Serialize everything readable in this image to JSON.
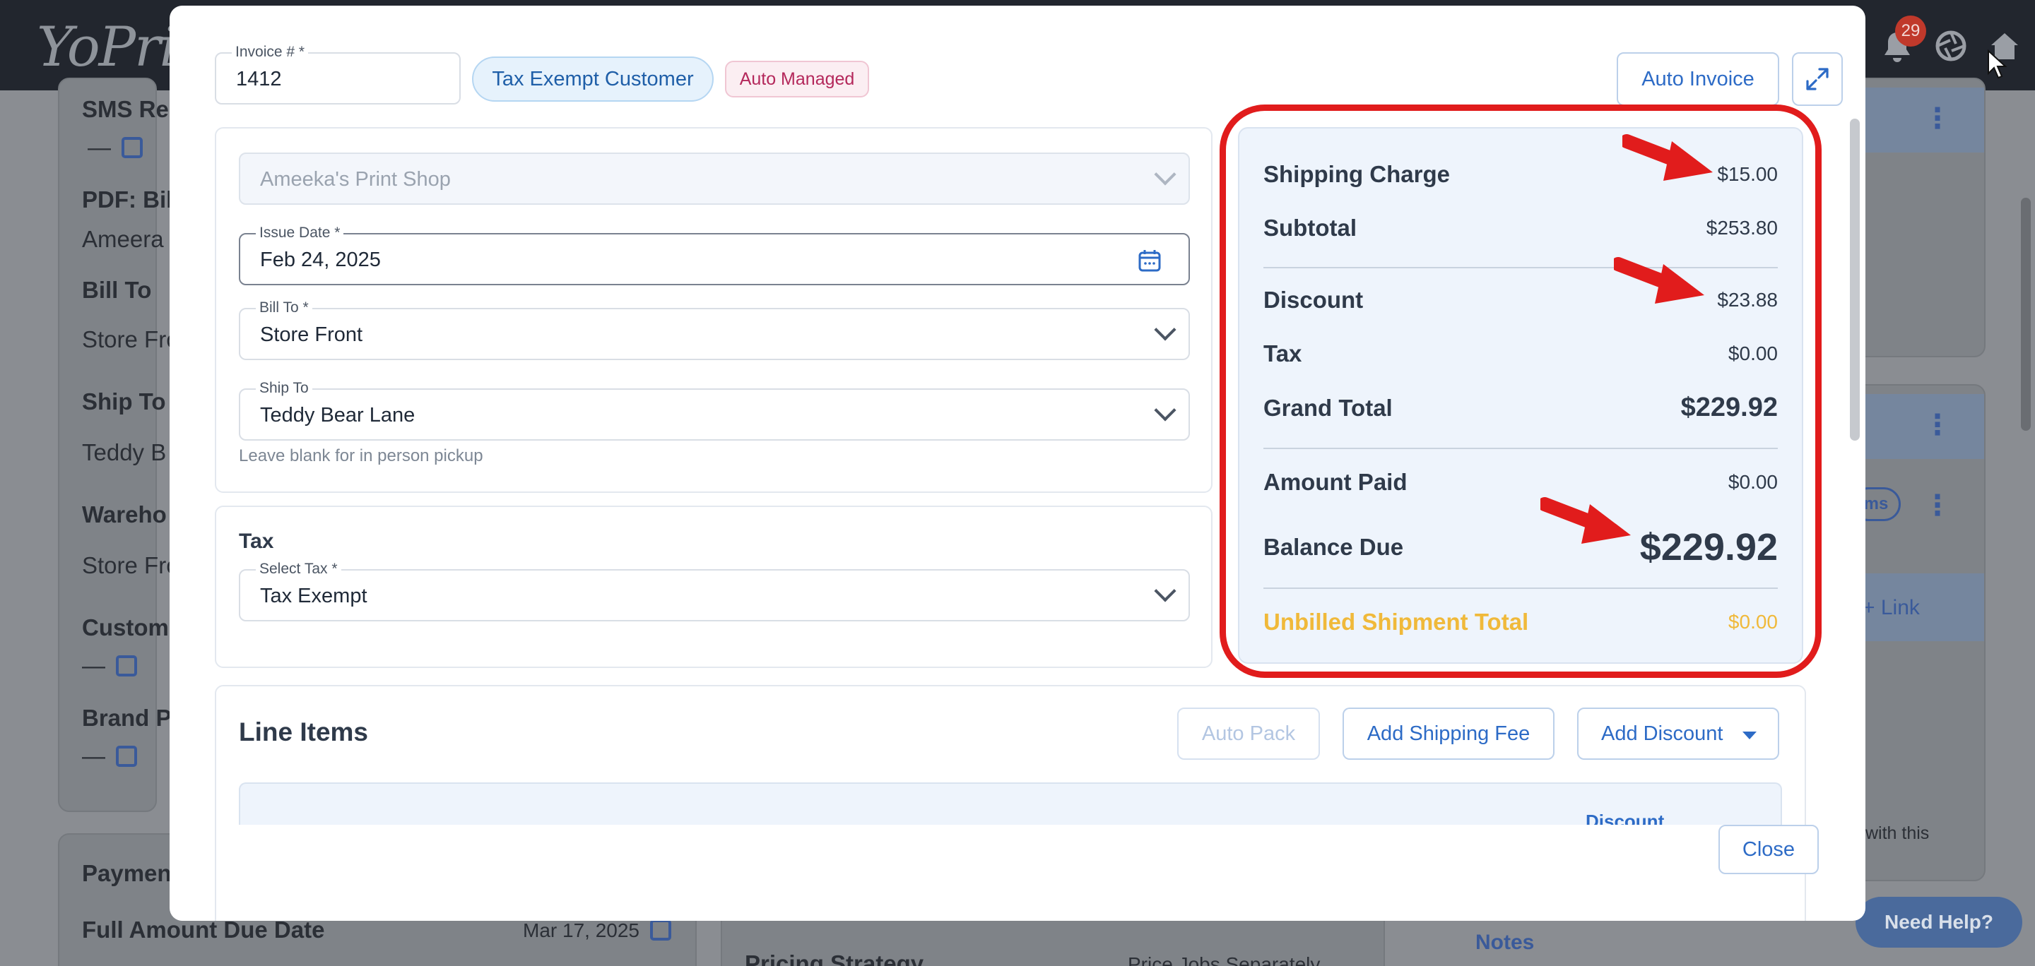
{
  "app": {
    "logo": "YoPrint",
    "notification_count": "29"
  },
  "background": {
    "sms_label": "SMS Re",
    "sms_value": "—",
    "pdf_label": "PDF: Bill",
    "pdf_value": "Ameera",
    "bill_to_label": "Bill To",
    "bill_to_value": "Store Fro",
    "ship_to_label": "Ship To",
    "ship_to_value": "Teddy B",
    "warehouse_label": "Wareho",
    "warehouse_value": "Store Fro",
    "customer_label": "Custome",
    "customer_value": "—",
    "brand_label": "Brand Pr",
    "brand_value": "—",
    "payment_label": "Paymen",
    "full_due_label": "Full Amount Due Date",
    "full_due_value": "Mar 17, 2025",
    "pricing_label": "Pricing Strategy",
    "pricing_value": "Price Jobs Separately",
    "ms_badge": "ms",
    "link_label": "+ Link",
    "with_this": "with this",
    "notes_label": "Notes",
    "need_help": "Need Help?"
  },
  "modal": {
    "invoice_label": "Invoice # *",
    "invoice_number": "1412",
    "tax_exempt_badge": "Tax Exempt Customer",
    "auto_managed_badge": "Auto Managed",
    "auto_invoice_button": "Auto Invoice",
    "customer_select_value": "Ameeka's Print Shop",
    "issue_date_label": "Issue Date *",
    "issue_date_value": "Feb 24, 2025",
    "bill_to_label": "Bill To *",
    "bill_to_value": "Store Front",
    "ship_to_label": "Ship To",
    "ship_to_value": "Teddy Bear Lane",
    "ship_to_hint": "Leave blank for in person pickup",
    "tax_section_title": "Tax",
    "select_tax_label": "Select Tax *",
    "select_tax_value": "Tax Exempt",
    "line_items_title": "Line Items",
    "auto_pack_button": "Auto Pack",
    "add_shipping_fee_button": "Add Shipping Fee",
    "add_discount_button": "Add Discount",
    "line_items_column_partial": "Discount",
    "close_button": "Close"
  },
  "totals": {
    "shipping_charge_label": "Shipping Charge",
    "shipping_charge_value": "$15.00",
    "subtotal_label": "Subtotal",
    "subtotal_value": "$253.80",
    "discount_label": "Discount",
    "discount_value": "$23.88",
    "tax_label": "Tax",
    "tax_value": "$0.00",
    "grand_total_label": "Grand Total",
    "grand_total_value": "$229.92",
    "amount_paid_label": "Amount Paid",
    "amount_paid_value": "$0.00",
    "balance_due_label": "Balance Due",
    "balance_due_value": "$229.92",
    "unbilled_label": "Unbilled Shipment Total",
    "unbilled_value": "$0.00"
  },
  "colors": {
    "accent_blue": "#2d6bc6",
    "annotation_red": "#e11c1c",
    "unbilled_amber": "#f0b93a",
    "auto_managed_pink": "#b4285b"
  }
}
